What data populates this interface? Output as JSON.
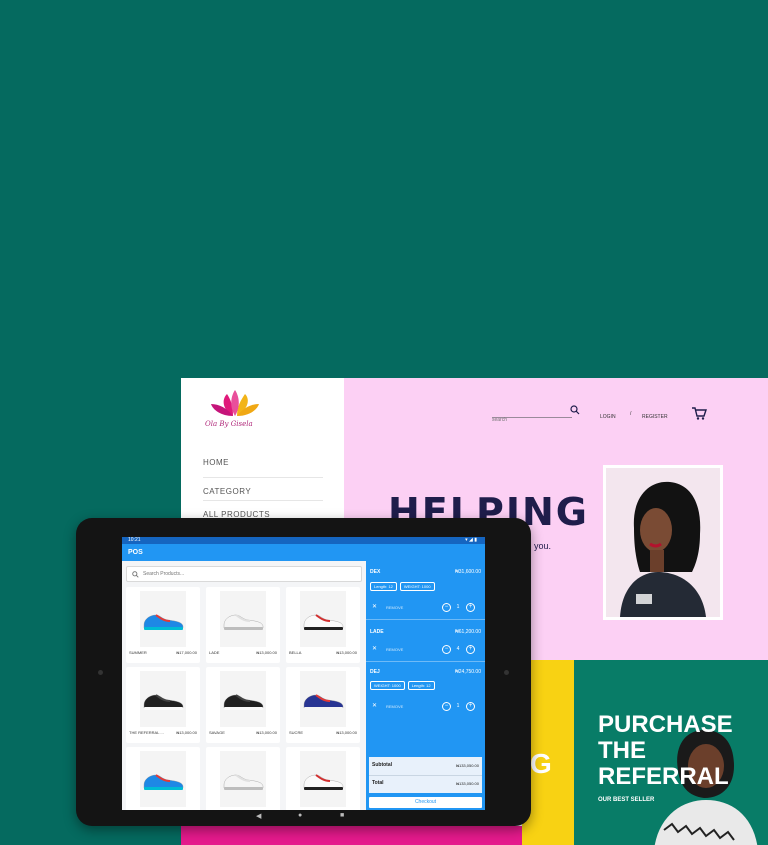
{
  "website": {
    "logo_script": "Ola By Gisela",
    "nav": [
      "HOME",
      "CATEGORY",
      "ALL PRODUCTS"
    ],
    "search": {
      "placeholder": "search"
    },
    "login": "LOGIN",
    "divider": "/",
    "register": "REGISTER",
    "hero_title": "HELPING",
    "hero_sub": "you.",
    "banner_letter": "G",
    "promo": {
      "line1": "PURCHASE",
      "line2": "THE",
      "line3": "REFERRAL",
      "sub": "OUR BEST SELLER"
    },
    "colors": {
      "hero_bg": "#fcd0f4",
      "title": "#1f1d4b",
      "yellow": "#f8d213",
      "green": "#087c67",
      "pink": "#e51a8c"
    }
  },
  "tablet": {
    "status_time": "10:21",
    "app_title": "POS",
    "search_placeholder": "Search Products...",
    "products": [
      {
        "name": "SUMMER",
        "price": "₦17,000.00",
        "shoe": "colorful-sneaker"
      },
      {
        "name": "LADE",
        "price": "₦13,000.00",
        "shoe": "white-sneaker"
      },
      {
        "name": "BELLA",
        "price": "₦13,000.00",
        "shoe": "red-white-sneaker"
      },
      {
        "name": "THE REFERRAL ...",
        "price": "₦13,000.00",
        "shoe": "black-sneaker"
      },
      {
        "name": "SAVAGE",
        "price": "₦13,000.00",
        "shoe": "black-sneaker"
      },
      {
        "name": "SUCRE",
        "price": "₦13,000.00",
        "shoe": "navy-sneaker"
      },
      {
        "name": "",
        "price": "",
        "shoe": "colorful-sneaker"
      },
      {
        "name": "",
        "price": "",
        "shoe": "white-sneaker"
      },
      {
        "name": "",
        "price": "",
        "shoe": "red-white-sneaker"
      }
    ],
    "cart": [
      {
        "name": "DEX",
        "price": "₦31,600.00",
        "chips": [
          "Length: 12",
          "WEIGHT: 1000"
        ],
        "remove": "REMOVE",
        "qty": "1"
      },
      {
        "name": "LADE",
        "price": "₦61,200.00",
        "chips": [],
        "remove": "REMOVE",
        "qty": "4"
      },
      {
        "name": "DEJ",
        "price": "₦24,750.00",
        "chips": [
          "WEIGHT: 1000",
          "Length: 12"
        ],
        "remove": "REMOVE",
        "qty": "1"
      }
    ],
    "subtotal_label": "Subtotal",
    "subtotal_value": "₦133,050.00",
    "total_label": "Total",
    "total_value": "₦133,050.00",
    "checkout": "Checkout",
    "colors": {
      "primary": "#2196f3",
      "statusbar": "#1565c0"
    }
  }
}
